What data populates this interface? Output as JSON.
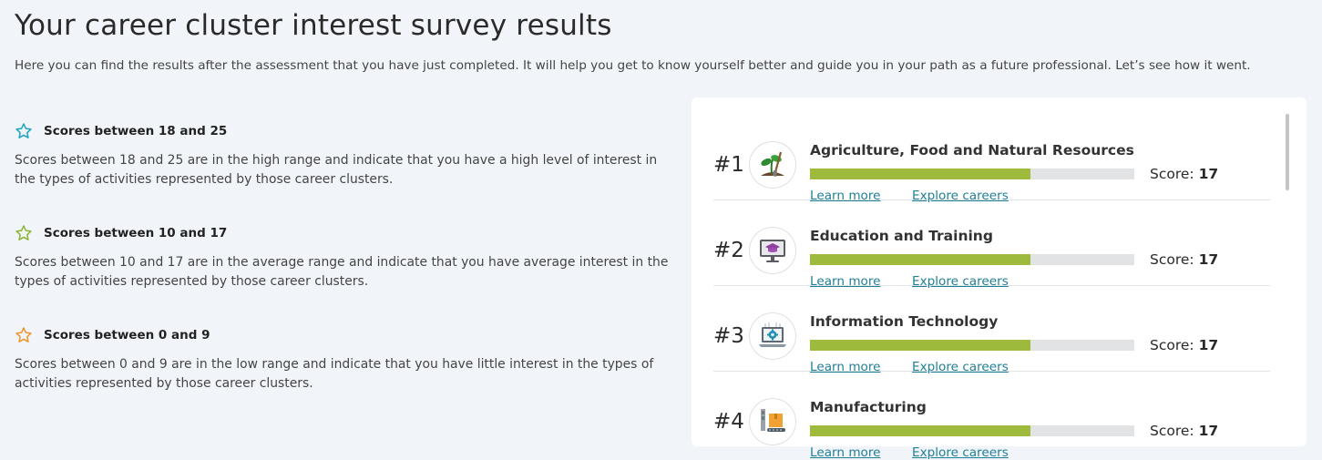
{
  "page": {
    "title": "Your career cluster interest survey results",
    "intro": "Here you can find the results after the assessment that you have just completed. It will help you get to know yourself better and guide you in your path as a future professional. Let’s see how it went."
  },
  "legend": [
    {
      "title": "Scores between 18 and 25",
      "description": "Scores between 18 and 25 are in the high range and indicate that you have a high level of interest in the types of activities represented by those career clusters.",
      "icon": "star-outline-icon",
      "color": "#1da1c4"
    },
    {
      "title": "Scores between 10 and 17",
      "description": "Scores between 10 and 17 are in the average range and indicate that you have average interest in the types of activities represented by those career clusters.",
      "icon": "star-outline-icon",
      "color": "#8ab431"
    },
    {
      "title": "Scores between 0 and 9",
      "description": "Scores between 0 and 9 are in the low range and indicate that you have little interest in the types of activities represented by those career clusters.",
      "icon": "star-outline-icon",
      "color": "#f0932b"
    }
  ],
  "results": {
    "score_label": "Score:",
    "learn_more_label": "Learn more",
    "explore_careers_label": "Explore careers",
    "score_max": 25,
    "bar_color": "#9dba3c",
    "items": [
      {
        "rank": "#1",
        "name": "Agriculture, Food and Natural Resources",
        "score": "17",
        "icon": "plant-shovel-icon"
      },
      {
        "rank": "#2",
        "name": "Education and Training",
        "score": "17",
        "icon": "graduation-monitor-icon"
      },
      {
        "rank": "#3",
        "name": "Information Technology",
        "score": "17",
        "icon": "gear-laptop-icon"
      },
      {
        "rank": "#4",
        "name": "Manufacturing",
        "score": "17",
        "icon": "factory-box-icon"
      }
    ]
  }
}
